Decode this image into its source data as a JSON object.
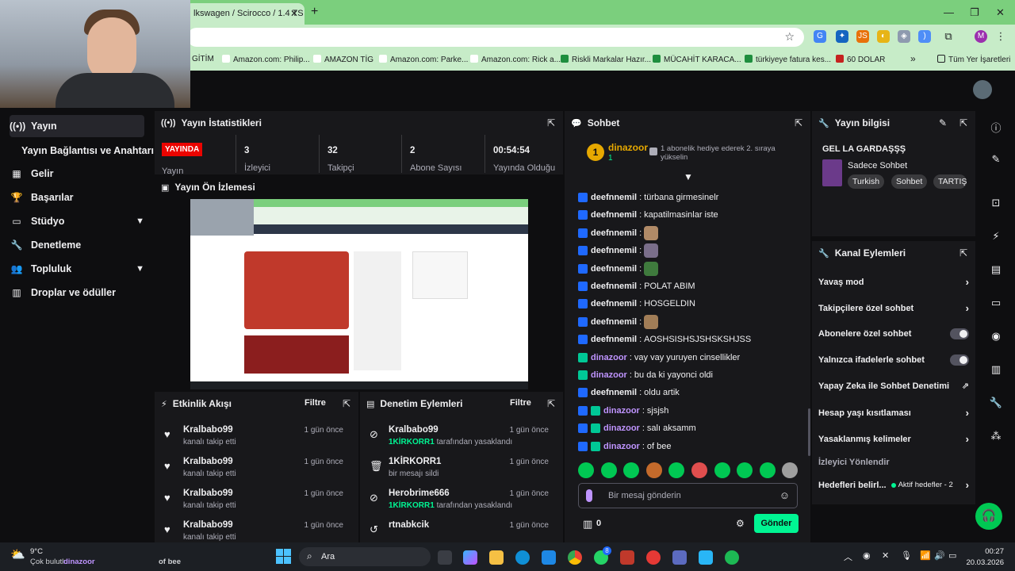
{
  "browser": {
    "tab_title": "lkswagen / Scirocco / 1.4 TS",
    "bookmarks": [
      "GİTİM",
      "Amazon.com: Philip...",
      "AMAZON TİG",
      "Amazon.com: Parke...",
      "Amazon.com: Rick a...",
      "Riskli Markalar Hazır...",
      "MÜCAHİT KARACA...",
      "türkiyeye fatura kes...",
      "60 DOLAR"
    ],
    "all_bookmarks": "Tüm Yer İşaretleri",
    "profile_letter": "M"
  },
  "sidebar": {
    "items": [
      {
        "label": "Yayın",
        "icon": "((•))"
      },
      {
        "label": "Yayın Bağlantısı ve Anahtarı",
        "icon": ""
      },
      {
        "label": "Gelir",
        "icon": "▦"
      },
      {
        "label": "Başarılar",
        "icon": "🏆"
      },
      {
        "label": "Stüdyo",
        "icon": "▭"
      },
      {
        "label": "Denetleme",
        "icon": "🔧"
      },
      {
        "label": "Topluluk",
        "icon": "👥"
      },
      {
        "label": "Droplar ve ödüller",
        "icon": "▥"
      }
    ]
  },
  "stats": {
    "title": "Yayın İstatistikleri",
    "live_badge": "YAYINDA",
    "values": [
      "3",
      "32",
      "2",
      "00:54:54"
    ],
    "labels": [
      "Yayın",
      "İzleyici",
      "Takipçi",
      "Abone Sayısı",
      "Yayında Olduğu"
    ]
  },
  "preview": {
    "title": "Yayın Ön İzlemesi"
  },
  "events": {
    "title": "Etkinlik Akışı",
    "filter": "Filtre",
    "items": [
      {
        "name": "Kralbabo99",
        "sub": "kanalı takip etti",
        "time": "1 gün önce"
      },
      {
        "name": "Kralbabo99",
        "sub": "kanalı takip etti",
        "time": "1 gün önce"
      },
      {
        "name": "Kralbabo99",
        "sub": "kanalı takip etti",
        "time": "1 gün önce"
      },
      {
        "name": "Kralbabo99",
        "sub": "kanalı takip etti",
        "time": "1 gün önce"
      }
    ]
  },
  "mod": {
    "title": "Denetim Eylemleri",
    "filter": "Filtre",
    "items": [
      {
        "name": "Kralbabo99",
        "actor": "1KİRKORR1",
        "sub": "tarafından yasaklandı",
        "time": "1 gün önce"
      },
      {
        "name": "1KİRKORR1",
        "actor": "",
        "sub": "bir mesajı sildi",
        "time": "1 gün önce"
      },
      {
        "name": "Herobrime666",
        "actor": "1KİRKORR1",
        "sub": "tarafından yasaklandı",
        "time": "1 gün önce"
      },
      {
        "name": "rtnabkcik",
        "actor": "",
        "sub": "",
        "time": "1 gün önce"
      }
    ]
  },
  "chat": {
    "title": "Sohbet",
    "top_user": "dinazoor",
    "top_count": "1",
    "top_rank": "1",
    "gift_text": "1 abonelik hediye ederek 2. sıraya yükselin",
    "messages": [
      {
        "user": "deefnnemil",
        "text": "türbana girmesinelr",
        "badge": "prime"
      },
      {
        "user": "deefnnemil",
        "text": "kapatilmasinlar iste",
        "badge": "prime"
      },
      {
        "user": "deefnnemil",
        "text": "",
        "badge": "prime",
        "emote": true
      },
      {
        "user": "deefnnemil",
        "text": "",
        "badge": "prime",
        "emote": true
      },
      {
        "user": "deefnnemil",
        "text": "",
        "badge": "prime",
        "emote": true
      },
      {
        "user": "deefnnemil",
        "text": "POLAT ABIM",
        "badge": "prime"
      },
      {
        "user": "deefnnemil",
        "text": "HOSGELDIN",
        "badge": "prime"
      },
      {
        "user": "deefnnemil",
        "text": "",
        "badge": "prime",
        "emote": true
      },
      {
        "user": "deefnnemil",
        "text": "AOSHSISHSJSHSKSHJSS",
        "badge": "prime"
      },
      {
        "user": "dinazoor",
        "text": "vay vay yuruyen cinsellikler",
        "badge": "sub"
      },
      {
        "user": "dinazoor",
        "text": "bu da ki yayonci oldi",
        "badge": "sub"
      },
      {
        "user": "deefnnemil",
        "text": "oldu artik",
        "badge": "prime"
      },
      {
        "user": "dinazoor",
        "text": "sjsjsh",
        "badge": "both"
      },
      {
        "user": "dinazoor",
        "text": "salı aksamm",
        "badge": "both"
      },
      {
        "user": "dinazoor",
        "text": "of bee",
        "badge": "both"
      }
    ],
    "input_placeholder": "Bir mesaj gönderin",
    "points": "0",
    "send": "Gönder"
  },
  "stream_info": {
    "title": "Yayın bilgisi",
    "stream_title": "GEL LA GARDAŞŞŞ",
    "category": "Sadece Sohbet",
    "tags": [
      "Turkish",
      "Sohbet",
      "TARTIŞ"
    ]
  },
  "channel_actions": {
    "title": "Kanal Eylemleri",
    "items": [
      {
        "label": "Yavaş mod",
        "control": "arrow"
      },
      {
        "label": "Takipçilere özel sohbet",
        "control": "arrow"
      },
      {
        "label": "Abonelere özel sohbet",
        "control": "toggle"
      },
      {
        "label": "Yalnızca ifadelerle sohbet",
        "control": "toggle"
      },
      {
        "label": "Yapay Zeka ile Sohbet Denetimi",
        "control": "external"
      },
      {
        "label": "Hesap yaşı kısıtlaması",
        "control": "arrow"
      },
      {
        "label": "Yasaklanmış kelimeler",
        "control": "arrow"
      }
    ],
    "section": "İzleyici Yönlendir",
    "goals_label": "Hedefleri belirl...",
    "goals_status": "Aktif hedefler - 2"
  },
  "taskbar": {
    "weather_temp": "9°C",
    "weather_desc": "Çok bulutlu",
    "notif_user": "dinazoor",
    "notif_text": "of bee",
    "search": "Ara",
    "time": "00:27",
    "date": "20.03.2026",
    "whatsapp_badge": "8"
  },
  "colors": {
    "accent": "#00f593",
    "live": "#eb0400",
    "send": "#00f593",
    "background": "#0e0e10",
    "panel": "#18181b"
  }
}
